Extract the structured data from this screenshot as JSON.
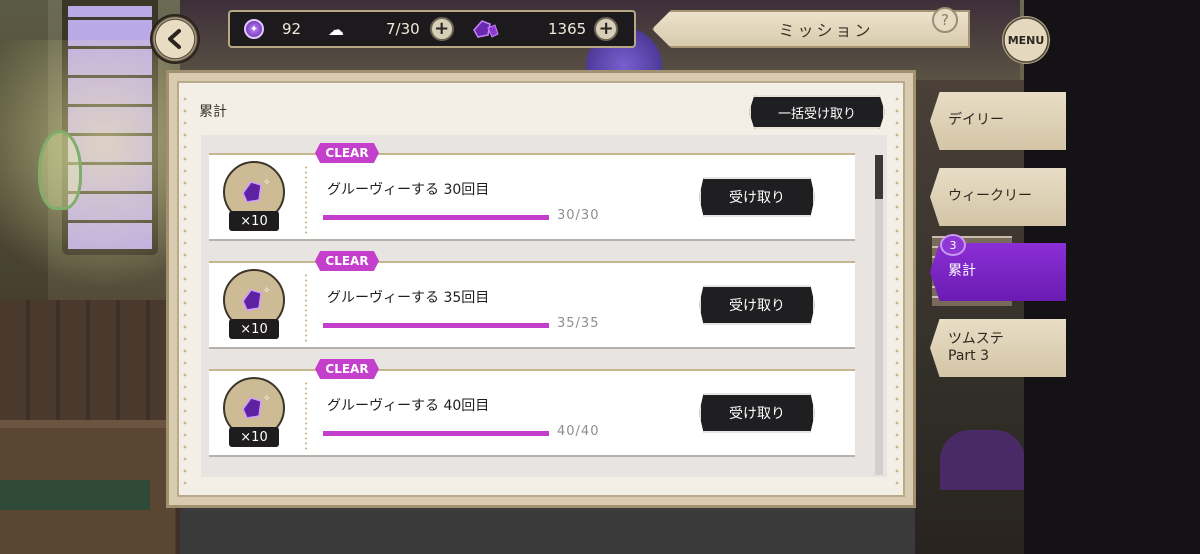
{
  "header": {
    "title": "ミッション",
    "help_label": "?",
    "menu_label": "MENU"
  },
  "resources": {
    "gems": "92",
    "stamina": "7/30",
    "crystals": "1365",
    "plus_label": "+"
  },
  "panel": {
    "label": "累計",
    "bulk_claim_label": "一括受け取り"
  },
  "missions": [
    {
      "tag": "CLEAR",
      "title": "グルーヴィーする 30回目",
      "progress_text": "30/30",
      "progress": 1.0,
      "reward_qty": "×10",
      "claim_label": "受け取り"
    },
    {
      "tag": "CLEAR",
      "title": "グルーヴィーする 35回目",
      "progress_text": "35/35",
      "progress": 1.0,
      "reward_qty": "×10",
      "claim_label": "受け取り"
    },
    {
      "tag": "CLEAR",
      "title": "グルーヴィーする 40回目",
      "progress_text": "40/40",
      "progress": 1.0,
      "reward_qty": "×10",
      "claim_label": "受け取り"
    }
  ],
  "tabs": [
    {
      "label": "デイリー",
      "active": false
    },
    {
      "label": "ウィークリー",
      "active": false
    },
    {
      "label": "累計",
      "active": true,
      "badge": "3"
    },
    {
      "label": "ツムステ",
      "label2": "Part 3",
      "active": false
    }
  ],
  "colors": {
    "accent": "#c33fcb",
    "active_tab": "#7a25c4"
  },
  "icons": {
    "back": "back-arrow-icon",
    "gem": "gem-icon",
    "stamina": "stamina-icon",
    "crystal": "crystal-icon",
    "reward": "crystal-icon"
  }
}
